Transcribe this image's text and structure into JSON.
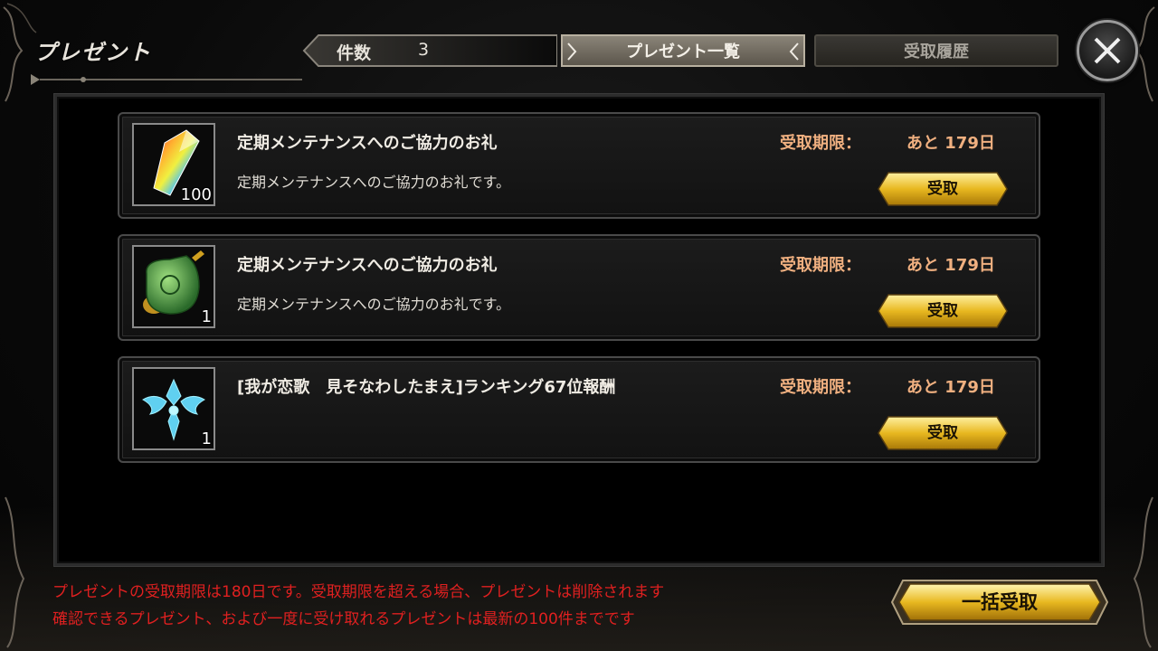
{
  "header": {
    "title": "プレゼント",
    "count_label": "件数",
    "count_value": "3"
  },
  "tabs": [
    {
      "label": "プレゼント一覧",
      "active": true
    },
    {
      "label": "受取履歴",
      "active": false
    }
  ],
  "close_icon": "close-x-icon",
  "presents": [
    {
      "icon": "rainbow-crystal-icon",
      "quantity": "100",
      "title": "定期メンテナンスへのご協力のお礼",
      "description": "定期メンテナンスへのご協力のお礼です。",
      "deadline_label": "受取期限：",
      "deadline_value": "あと 179日",
      "button_label": "受取"
    },
    {
      "icon": "green-potion-icon",
      "quantity": "1",
      "title": "定期メンテナンスへのご協力のお礼",
      "description": "定期メンテナンスへのご協力のお礼です。",
      "deadline_label": "受取期限：",
      "deadline_value": "あと 179日",
      "button_label": "受取"
    },
    {
      "icon": "blue-crest-icon",
      "quantity": "1",
      "title": "[我が恋歌　見そなわしたまえ]ランキング67位報酬",
      "description": "",
      "deadline_label": "受取期限：",
      "deadline_value": "あと 179日",
      "button_label": "受取"
    }
  ],
  "footer": {
    "note_1": "プレゼントの受取期限は180日です。受取期限を超える場合、プレゼントは削除されます",
    "note_2": "確認できるプレゼント、および一度に受け取れるプレゼントは最新の100件までです",
    "bulk_button_label": "一括受取"
  },
  "colors": {
    "deadline": "#f0b080",
    "note": "#e02020",
    "gold_button": "#e8b820"
  }
}
